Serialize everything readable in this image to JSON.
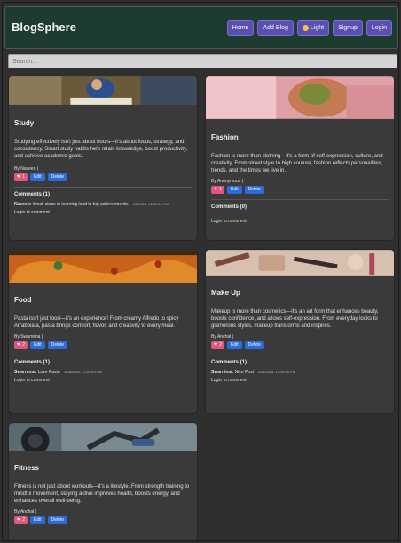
{
  "app": {
    "brand": "BlogSphere"
  },
  "nav": {
    "home": "Home",
    "add_blog": "Add Blog",
    "light": "Light",
    "signup": "Signup",
    "login": "Login"
  },
  "search": {
    "placeholder": "Search..."
  },
  "posts": [
    {
      "title": "Study",
      "text": "Studying effectively isn't just about hours—it's about focus, strategy, and consistency. Smart study habits help retain knowledge, boost productivity, and achieve academic goals.",
      "author": "By Naveen |",
      "likes": "1",
      "edit": "Edit",
      "delete": "Delete",
      "comments_title": "Comments (1)",
      "comment_author": "Naveen:",
      "comment_text": "Small steps in learning lead to big achievements.",
      "comment_date": "3/5/2025, 12:05:19 PM",
      "login_text": "Login to comment"
    },
    {
      "title": "Fashion",
      "text": "Fashion is more than clothing—it's a form of self-expression, culture, and creativity. From street style to high couture, fashion reflects personalities, trends, and the times we live in.",
      "author": "By Anonymous |",
      "likes": "1",
      "edit": "Edit",
      "delete": "Delete",
      "comments_title": "Comments (0)",
      "login_text": "Login to comment"
    },
    {
      "title": "Food",
      "text": "Pasta isn't just food—it's an experience! From creamy Alfredo to spicy Arrabbiata, pasta brings comfort, flavor, and creativity to every meal.",
      "author": "By Swarnima |",
      "likes": "2",
      "edit": "Edit",
      "delete": "Delete",
      "comments_title": "Comments (1)",
      "comment_author": "Swarnima:",
      "comment_text": "Love Pasta",
      "comment_date": "3/28/2025, 10:20:43 PM",
      "login_text": "Login to comment"
    },
    {
      "title": "Make Up",
      "text": "Makeup is more than cosmetics—it's an art form that enhances beauty, boosts confidence, and allows self-expression. From everyday looks to glamorous styles, makeup transforms and inspires.",
      "author": "By Anchal |",
      "likes": "2",
      "edit": "Edit",
      "delete": "Delete",
      "comments_title": "Comments (1)",
      "comment_author": "Swarnima:",
      "comment_text": "Nice Post",
      "comment_date": "3/28/2025, 12:20:00 PM",
      "login_text": "Login to comment"
    },
    {
      "title": "Fitness",
      "text": "Fitness is not just about workouts—it's a lifestyle. From strength training to mindful movement, staying active improves health, boosts energy, and enhances overall well-being.",
      "author": "By Anchal |",
      "likes": "2",
      "edit": "Edit",
      "delete": "Delete"
    }
  ],
  "icons": {
    "like": "heart-icon",
    "theme": "sun-icon"
  },
  "colors": {
    "navbar": "#1e3b2f",
    "nav_button": "#5a4fb0",
    "like": "#e0567e",
    "action": "#2c6cd9",
    "card": "#3a3a3a"
  }
}
